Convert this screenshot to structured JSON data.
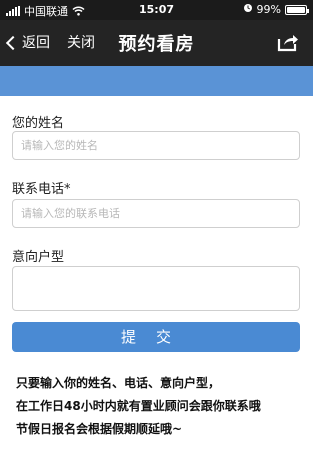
{
  "status_bar": {
    "carrier": "中国联通",
    "time": "15:07",
    "battery": "99%",
    "battery_level": 0.99
  },
  "nav": {
    "back_label": "返回",
    "close_label": "关闭",
    "title": "预约看房"
  },
  "form": {
    "name_label": "您的姓名",
    "name_placeholder": "请输入您的姓名",
    "phone_label": "联系电话*",
    "phone_placeholder": "请输入您的联系电话",
    "unit_label": "意向户型",
    "submit_label": "提交"
  },
  "note": {
    "line1": "只要输入你的姓名、电话、意向户型，",
    "line2": "在工作日48小时内就有置业顾问会跟你联系哦",
    "line3": "节假日报名会根据假期顺延哦~"
  },
  "colors": {
    "nav_bg": "#242424",
    "accent": "#4a8ad3",
    "band": "#5a93d6"
  }
}
